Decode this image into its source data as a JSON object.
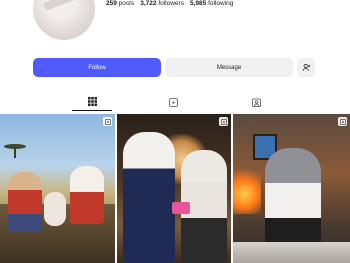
{
  "profile": {
    "posts_count": "259",
    "posts_label": "posts",
    "followers_count": "3,722",
    "followers_label": "followers",
    "following_count": "5,985",
    "following_label": "following"
  },
  "actions": {
    "follow_label": "Follow",
    "message_label": "Message"
  },
  "tabs": [
    {
      "name": "posts",
      "icon": "grid-icon"
    },
    {
      "name": "reels",
      "icon": "reels-icon"
    },
    {
      "name": "tagged",
      "icon": "tagged-icon"
    }
  ],
  "posts": [
    {
      "icon": "reel-badge-icon"
    },
    {
      "icon": "reel-badge-icon"
    },
    {
      "icon": "reel-badge-icon"
    }
  ],
  "colors": {
    "accent": "#4f5bff",
    "button_secondary": "#f0f0f0"
  }
}
